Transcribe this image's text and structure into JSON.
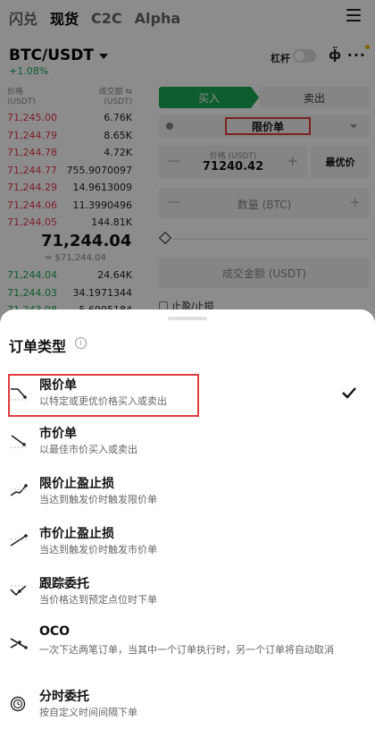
{
  "topnav": {
    "items": [
      {
        "label": "闪兑",
        "active": false
      },
      {
        "label": "现货",
        "active": true
      },
      {
        "label": "C2C",
        "active": false
      },
      {
        "label": "Alpha",
        "active": false
      }
    ],
    "menu_icon": "hamburger-menu-icon"
  },
  "pair": {
    "symbol": "BTC/USDT",
    "change": "+1.08%",
    "leverage_label": "杠杆",
    "chart_icon": "candlestick-icon",
    "more_icon": "more-dots-icon"
  },
  "orderbook": {
    "price_header": "价格",
    "price_unit": "(USDT)",
    "qty_header": "成交额 ⇆",
    "qty_unit": "(USDT)",
    "asks": [
      {
        "price": "71,245.00",
        "qty": "6.76K"
      },
      {
        "price": "71,244.79",
        "qty": "8.65K"
      },
      {
        "price": "71,244.78",
        "qty": "4.72K"
      },
      {
        "price": "71,244.77",
        "qty": "755.9070097"
      },
      {
        "price": "71,244.29",
        "qty": "14.9613009"
      },
      {
        "price": "71,244.06",
        "qty": "11.3990496"
      },
      {
        "price": "71,244.05",
        "qty": "144.81K"
      }
    ],
    "mid_price": "71,244.04",
    "mid_sub": "≈ $71,244.04",
    "bids": [
      {
        "price": "71,244.04",
        "qty": "24.64K"
      },
      {
        "price": "71,244.03",
        "qty": "34.1971344"
      },
      {
        "price": "71,243.98",
        "qty": "5.6995184"
      }
    ]
  },
  "trade": {
    "buy_label": "买入",
    "sell_label": "卖出",
    "order_type": "限价单",
    "price_label": "价格 (USDT)",
    "price_value": "71240.42",
    "best_price_label": "最优价",
    "qty_placeholder": "数量 (BTC)",
    "amount_placeholder": "成交金额 (USDT)",
    "tpsl_label": "止盈/止损"
  },
  "sheet": {
    "title": "订单类型",
    "selected_index": 0,
    "options": [
      {
        "title": "限价单",
        "desc": "以特定或更优价格买入或卖出",
        "icon": "limit-order-icon"
      },
      {
        "title": "市价单",
        "desc": "以最佳市价买入或卖出",
        "icon": "market-order-icon"
      },
      {
        "title": "限价止盈止损",
        "desc": "当达到触发价时触发限价单",
        "icon": "stop-limit-icon"
      },
      {
        "title": "市价止盈止损",
        "desc": "当达到触发价时触发市价单",
        "icon": "stop-market-icon"
      },
      {
        "title": "跟踪委托",
        "desc": "当价格达到预定点位时下单",
        "icon": "trailing-stop-icon"
      },
      {
        "title": "OCO",
        "desc": "一次下达两笔订单，当其中一个订单执行时，另一个订单将自动取消",
        "icon": "oco-icon"
      },
      {
        "title": "分时委托",
        "desc": "按自定义时间间隔下单",
        "icon": "twap-clock-icon"
      }
    ]
  }
}
